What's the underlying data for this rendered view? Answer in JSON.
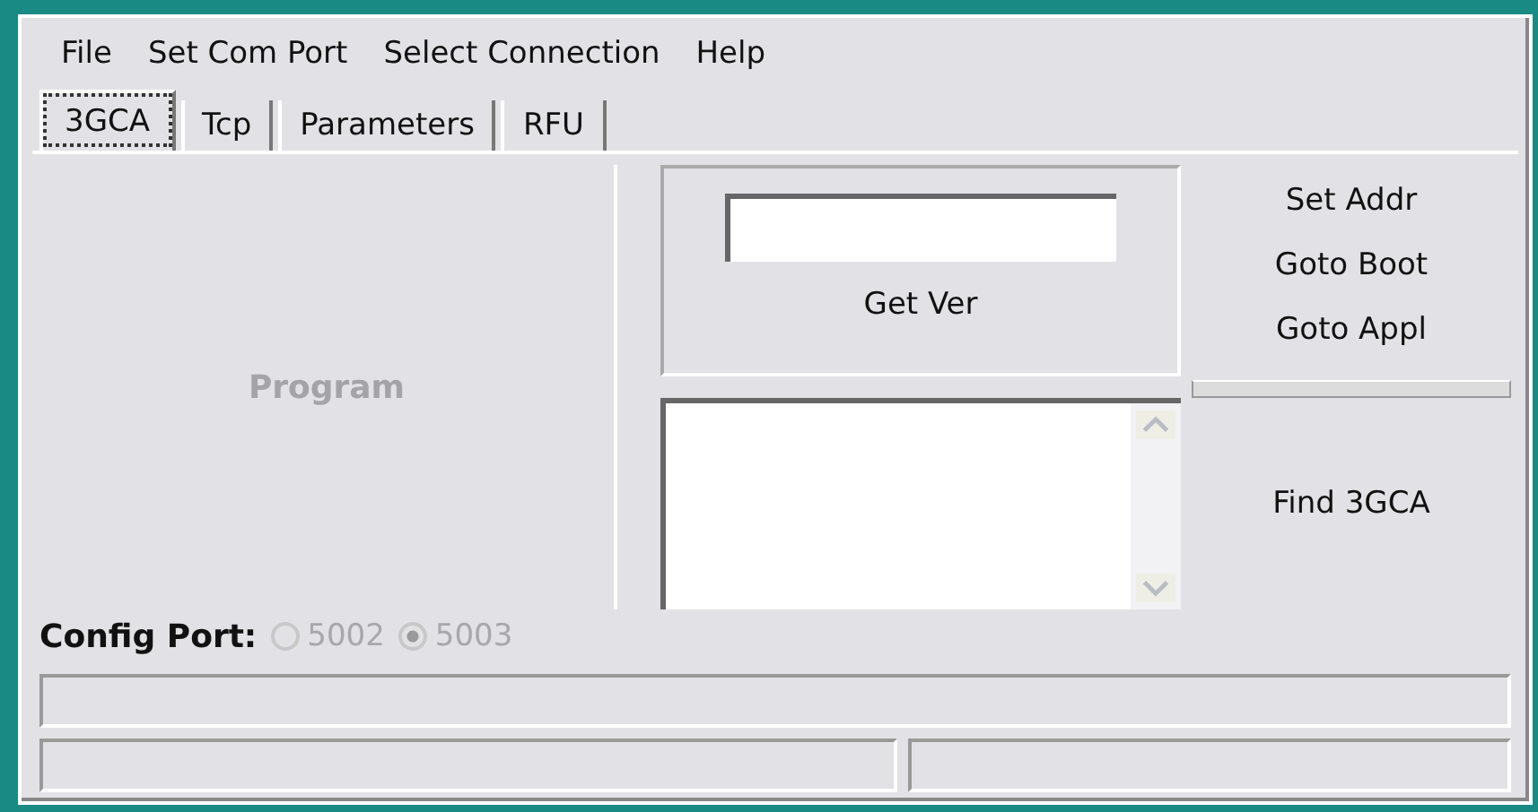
{
  "menu": [
    "File",
    "Set Com Port",
    "Select Connection",
    "Help"
  ],
  "tabs": [
    {
      "label": "3GCA",
      "selected": true
    },
    {
      "label": "Tcp",
      "selected": false
    },
    {
      "label": "Parameters",
      "selected": false
    },
    {
      "label": "RFU",
      "selected": false
    }
  ],
  "program_button": {
    "label": "Program",
    "disabled": true
  },
  "version_panel": {
    "button": "Get Ver"
  },
  "side_buttons": [
    "Set Addr",
    "Goto Boot",
    "Goto Appl"
  ],
  "progress": {
    "level": 0
  },
  "find_button": "Find 3GCA",
  "config_port": {
    "label": "Config Port:",
    "disabled": true,
    "options": [
      {
        "label": "5002",
        "selected": false
      },
      {
        "label": "5003",
        "selected": true
      }
    ]
  }
}
